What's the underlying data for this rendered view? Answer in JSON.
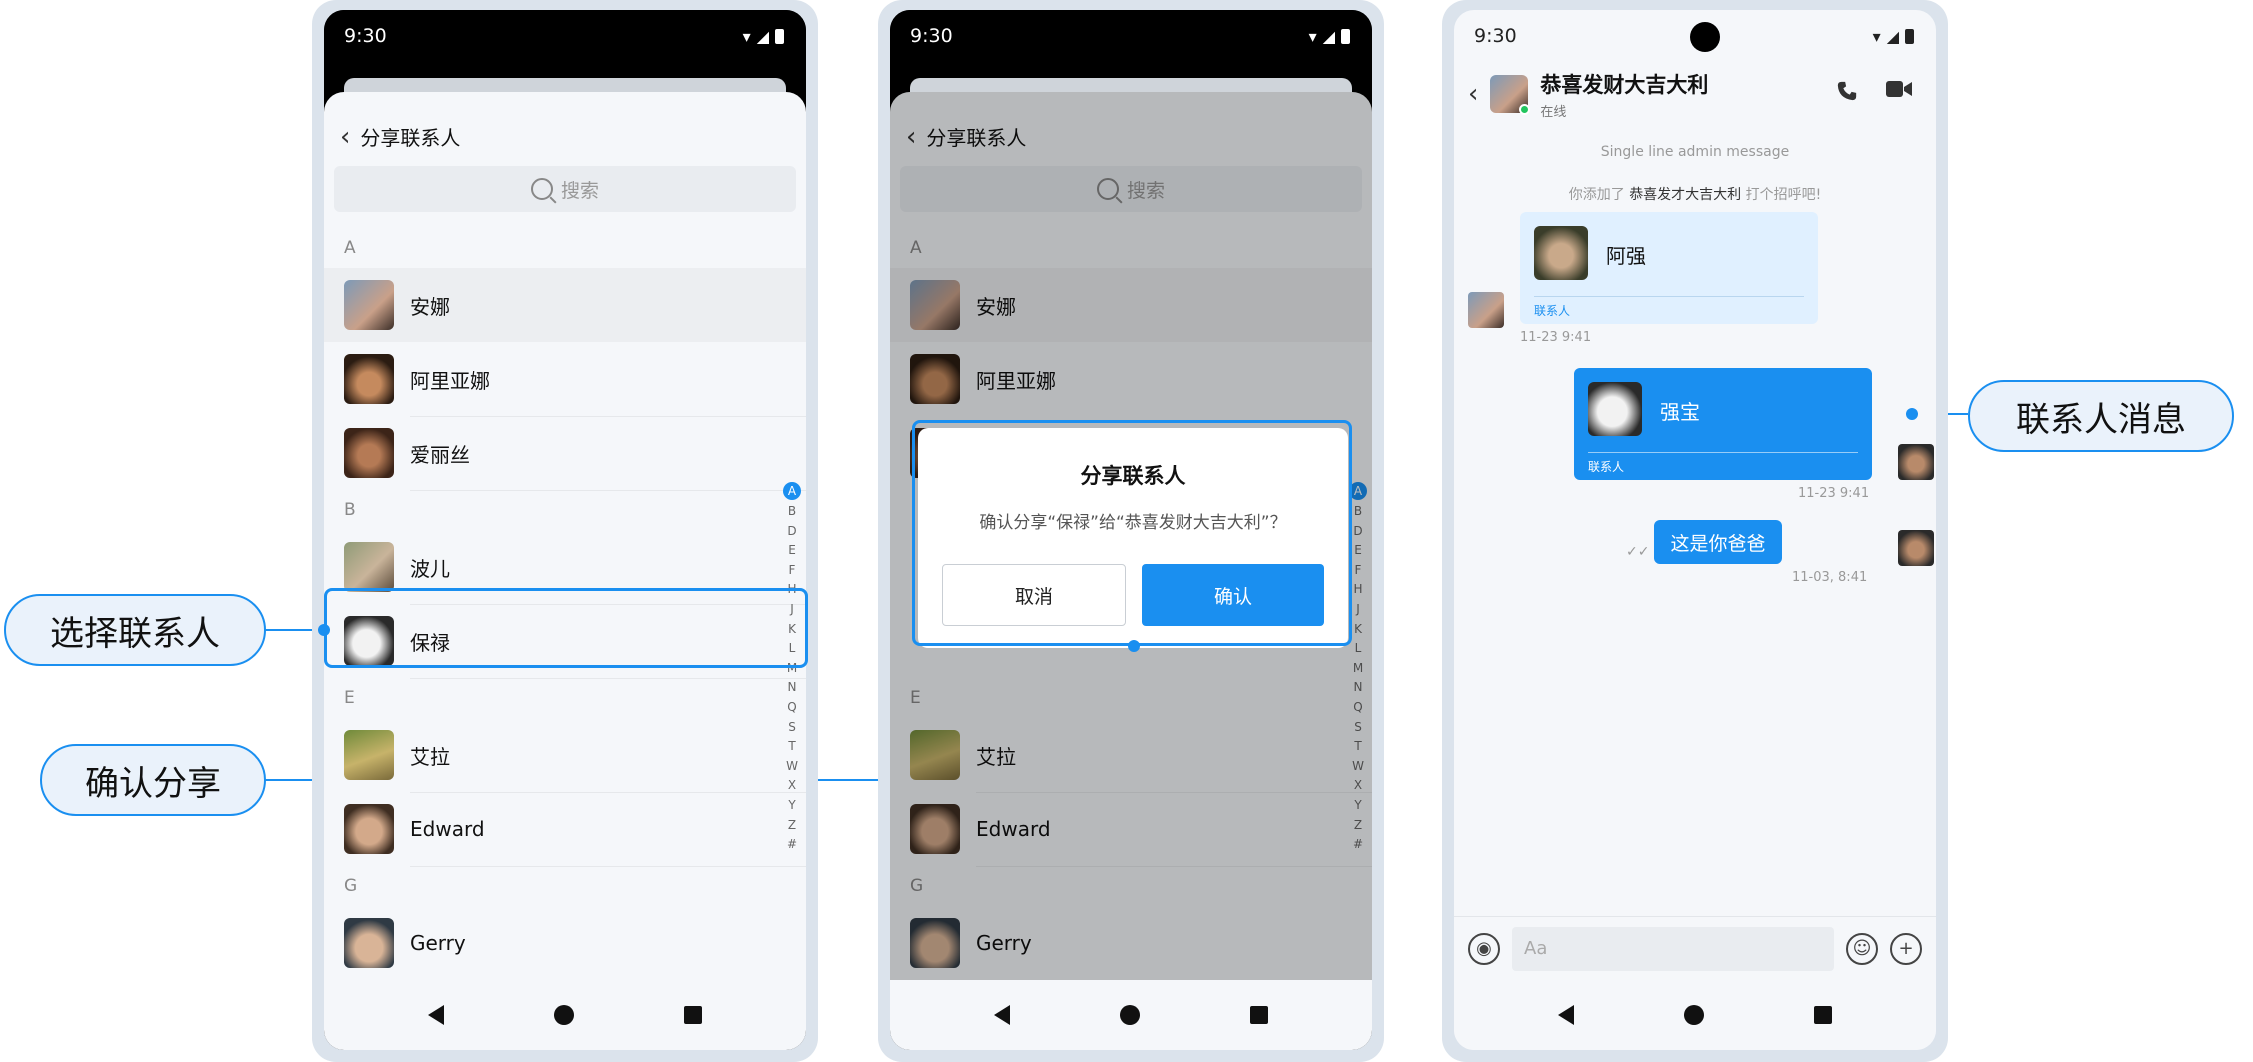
{
  "status": {
    "time": "9:30"
  },
  "contact_list": {
    "title": "分享联系人",
    "search_placeholder": "搜索",
    "sections": [
      {
        "letter": "A",
        "contacts": [
          "安娜",
          "阿里亚娜",
          "爱丽丝"
        ]
      },
      {
        "letter": "B",
        "contacts": [
          "波儿",
          "保禄"
        ]
      },
      {
        "letter": "E",
        "contacts": [
          "艾拉",
          "Edward"
        ]
      },
      {
        "letter": "G",
        "contacts": [
          "Gerry"
        ]
      }
    ],
    "index_letters": [
      "A",
      "B",
      "D",
      "E",
      "F",
      "H",
      "J",
      "K",
      "L",
      "M",
      "N",
      "Q",
      "S",
      "T",
      "W",
      "X",
      "Y",
      "Z",
      "#"
    ]
  },
  "dialog": {
    "title": "分享联系人",
    "message": "确认分享“保禄”给“恭喜发财大吉大利”？",
    "cancel": "取消",
    "confirm": "确认"
  },
  "chat": {
    "name": "恭喜发财大吉大利",
    "status": "在线",
    "admin_message": "Single line admin message",
    "added_prefix": "你添加了",
    "added_name": "恭喜发才大吉大利",
    "added_suffix": "打个招呼吧!",
    "card_in": {
      "name": "阿强",
      "label": "联系人",
      "time": "11-23 9:41"
    },
    "card_out": {
      "name": "强宝",
      "label": "联系人",
      "time": "11-23 9:41"
    },
    "text_message": {
      "text": "这是你爸爸",
      "time": "11-03, 8:41"
    },
    "input_placeholder": "Aa"
  },
  "callouts": {
    "select_contact": "选择联系人",
    "confirm_share": "确认分享",
    "contact_message": "联系人消息"
  },
  "colors": {
    "accent": "#1a8ff0",
    "online": "#22c55e"
  }
}
